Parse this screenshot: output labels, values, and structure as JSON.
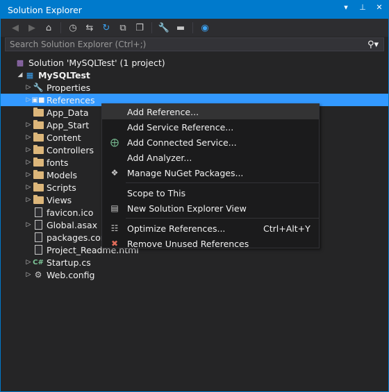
{
  "window": {
    "title": "Solution Explorer",
    "buttons": [
      "▾",
      "⊥",
      "✕"
    ]
  },
  "search": {
    "placeholder": "Search Solution Explorer (Ctrl+;)"
  },
  "tree": {
    "solution": "Solution 'MySQLTest' (1 project)",
    "project": "MySQLTest",
    "items": [
      {
        "label": "Properties",
        "icon": "wrench-icon",
        "expand": true
      },
      {
        "label": "References",
        "icon": "references-icon",
        "expand": true,
        "selected": true
      },
      {
        "label": "App_Data",
        "icon": "folder-icon",
        "expand": false
      },
      {
        "label": "App_Start",
        "icon": "folder-icon",
        "expand": true
      },
      {
        "label": "Content",
        "icon": "folder-icon",
        "expand": true
      },
      {
        "label": "Controllers",
        "icon": "folder-icon",
        "expand": true
      },
      {
        "label": "fonts",
        "icon": "folder-icon",
        "expand": true
      },
      {
        "label": "Models",
        "icon": "folder-icon",
        "expand": true
      },
      {
        "label": "Scripts",
        "icon": "folder-icon",
        "expand": true
      },
      {
        "label": "Views",
        "icon": "folder-icon",
        "expand": true
      },
      {
        "label": "favicon.ico",
        "icon": "file-icon",
        "expand": false
      },
      {
        "label": "Global.asax",
        "icon": "file-icon",
        "expand": true
      },
      {
        "label": "packages.config",
        "icon": "file-icon",
        "expand": false
      },
      {
        "label": "Project_Readme.html",
        "icon": "file-icon",
        "expand": false
      },
      {
        "label": "Startup.cs",
        "icon": "csharp-icon",
        "expand": true
      },
      {
        "label": "Web.config",
        "icon": "config-icon",
        "expand": true
      }
    ]
  },
  "context_menu": {
    "items": [
      {
        "label": "Add Reference...",
        "icon": "",
        "shortcut": "",
        "highlighted": true
      },
      {
        "label": "Add Service Reference...",
        "icon": "",
        "shortcut": ""
      },
      {
        "label": "Add Connected Service...",
        "icon": "connected-service-icon",
        "shortcut": ""
      },
      {
        "label": "Add Analyzer...",
        "icon": "",
        "shortcut": ""
      },
      {
        "label": "Manage NuGet Packages...",
        "icon": "nuget-icon",
        "shortcut": ""
      },
      {
        "label": "Scope to This",
        "icon": "",
        "shortcut": ""
      },
      {
        "label": "New Solution Explorer View",
        "icon": "new-view-icon",
        "shortcut": ""
      },
      {
        "label": "Optimize References...",
        "icon": "optimize-icon",
        "shortcut": "Ctrl+Alt+Y"
      },
      {
        "label": "Remove Unused References",
        "icon": "remove-references-icon",
        "shortcut": ""
      }
    ]
  },
  "colors": {
    "accent": "#007acc",
    "selection": "#3399ff",
    "background": "#252526",
    "folder": "#dcb67a"
  }
}
